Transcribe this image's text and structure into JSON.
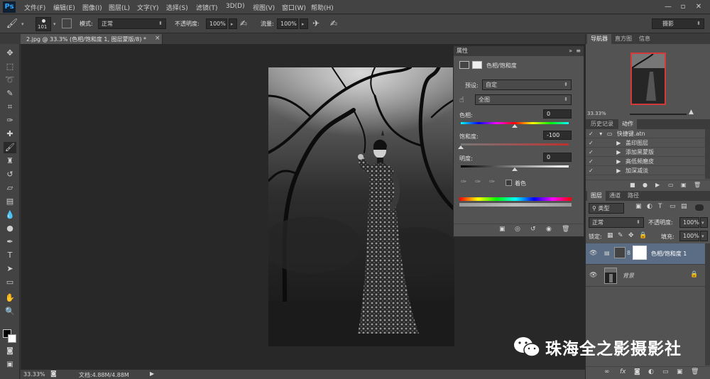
{
  "menu": {
    "logo": "Ps",
    "items": [
      "文件(F)",
      "编辑(E)",
      "图像(I)",
      "图层(L)",
      "文字(Y)",
      "选择(S)",
      "滤镜(T)",
      "3D(D)",
      "视图(V)",
      "窗口(W)",
      "帮助(H)"
    ],
    "minimize": "—",
    "restore": "▫",
    "close": "✕"
  },
  "options": {
    "brush_size": "101",
    "mode_label": "模式:",
    "mode_value": "正常",
    "opacity_label": "不透明度:",
    "opacity_value": "100%",
    "flow_label": "流量:",
    "flow_value": "100%",
    "workspace": "摄影"
  },
  "document": {
    "tab_title": "2.jpg @ 33.3% (色相/饱和度 1, 图层蒙版/8) *",
    "tab_close": "×",
    "zoom": "33.33%",
    "doc_info": "文档:4.88M/4.88M"
  },
  "properties": {
    "panel_title": "属性",
    "adjustment_name": "色相/饱和度",
    "preset_label": "预设:",
    "preset_value": "自定",
    "channel_value": "全图",
    "hue_label": "色相:",
    "hue_value": "0",
    "hue_position": 0.5,
    "saturation_label": "饱和度:",
    "saturation_value": "-100",
    "saturation_position": 0.0,
    "lightness_label": "明度:",
    "lightness_value": "0",
    "lightness_position": 0.5,
    "colorize_label": "着色"
  },
  "navigator": {
    "tabs": [
      "导航器",
      "直方图",
      "信息"
    ],
    "zoom": "33.33%"
  },
  "history": {
    "tabs": [
      "历史记录",
      "动作"
    ],
    "set_name": "快捷键.atn",
    "items": [
      "盖印图层",
      "添加黑蒙版",
      "高低频磨皮",
      "加深减淡"
    ]
  },
  "layers": {
    "tabs": [
      "图层",
      "通道",
      "路径"
    ],
    "filter_label": "类型",
    "blend_mode": "正常",
    "opacity_label": "不透明度:",
    "opacity_value": "100%",
    "lock_label": "锁定:",
    "fill_label": "填充:",
    "fill_value": "100%",
    "rows": [
      {
        "name": "色相/饱和度 1",
        "selected": true
      },
      {
        "name": "背景",
        "selected": false
      }
    ],
    "footer_icons": [
      "link-icon",
      "fx-icon",
      "mask-icon",
      "adjustment-icon",
      "group-icon",
      "new-layer-icon",
      "trash-icon"
    ],
    "footer_fx": "fx"
  },
  "watermark": {
    "text": "珠海全之影摄影社"
  },
  "colors": {
    "chrome": "#434343",
    "panel": "#535353",
    "canvas": "#282828",
    "selected_layer": "#5a6d85"
  }
}
